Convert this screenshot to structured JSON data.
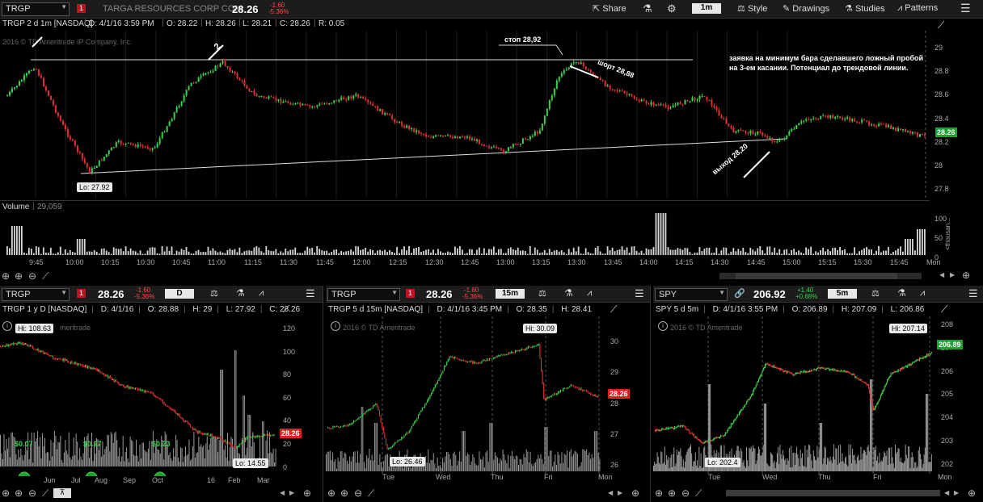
{
  "header": {
    "symbol": "TRGP",
    "company": "TARGA RESOURCES CORP COM",
    "price": "28.26",
    "chg": "-1.60",
    "chg_pct": "-5.36%",
    "share_label": "Share",
    "interval": "1m",
    "style_label": "Style",
    "drawings_label": "Drawings",
    "studies_label": "Studies",
    "patterns_label": "Patterns"
  },
  "main": {
    "info_title": "TRGP 2 d 1m [NASDAQ]",
    "info_d": "D: 4/1/16 3:59 PM",
    "info_o": "O: 28.22",
    "info_h": "H: 28.26",
    "info_l": "L: 28.21",
    "info_c": "C: 28.26",
    "info_r": "R: 0.05",
    "copyright": "2016 © TD Ameritrade IP Company, Inc.",
    "lo_label": "Lo: 27.92",
    "price_tag": "28.26",
    "touch_label": "2",
    "stop_label": "стоп 28,92",
    "short_label": "шорт 28,88",
    "exit_label": "выход 28,20",
    "note": "заявка на минимум бара сделавшего ложный пробой на 3-ем касании. Потенциал до трендовой линии.",
    "y_ticks": [
      "29",
      "28.8",
      "28.6",
      "28.4",
      "28.2",
      "28",
      "27.8"
    ],
    "x_ticks": [
      "9:45",
      "10:00",
      "10:15",
      "10:30",
      "10:45",
      "11:00",
      "11:15",
      "11:30",
      "11:45",
      "12:00",
      "12:15",
      "12:30",
      "12:45",
      "13:00",
      "13:15",
      "13:30",
      "13:45",
      "14:00",
      "14:15",
      "14:30",
      "14:45",
      "15:00",
      "15:15",
      "15:30",
      "15:45",
      "Mon"
    ],
    "volume_label": "Volume",
    "volume_value": "29,059",
    "vol_ticks": [
      "100",
      "50",
      "0"
    ],
    "vol_unit": "<thousan..."
  },
  "panel1": {
    "symbol": "TRGP",
    "price": "28.26",
    "chg": "-1.60",
    "chg_pct": "-5.36%",
    "interval": "D",
    "info_title": "TRGP 1 y D [NASDAQ]",
    "info_d": "D: 4/1/16",
    "info_o": "O: 28.88",
    "info_h": "H: 29",
    "info_l": "L: 27.92",
    "info_c": "C: 28.26",
    "copyright": "meritrade",
    "hi_label": "Hi: 108.63",
    "lo_label": "Lo: 14.55",
    "price_tag": "28.26",
    "div1": "$0.07",
    "div2": "$0.27",
    "div3": "$0.23",
    "y_ticks": [
      "120",
      "100",
      "80",
      "60",
      "40",
      "20",
      "0"
    ],
    "x_ticks": [
      "Jun",
      "Jul",
      "Aug",
      "Sep",
      "Oct",
      "16",
      "Feb",
      "Mar"
    ]
  },
  "panel2": {
    "symbol": "TRGP",
    "price": "28.26",
    "chg": "-1.60",
    "chg_pct": "-5.36%",
    "interval": "15m",
    "info_title": "TRGP 5 d 15m [NASDAQ]",
    "info_d": "D: 4/1/16 3:45 PM",
    "info_o": "O: 28.35",
    "info_h": "H: 28.41",
    "copyright": "2016 © TD Ameritrade",
    "hi_label": "Hi: 30.09",
    "lo_label": "Lo: 26.46",
    "price_tag": "28.26",
    "y_ticks": [
      "30",
      "29",
      "28",
      "27",
      "26"
    ],
    "x_ticks": [
      "Tue",
      "Wed",
      "Thu",
      "Fri",
      "Mon"
    ]
  },
  "panel3": {
    "symbol": "SPY",
    "price": "206.92",
    "chg": "+1.40",
    "chg_pct": "+0.68%",
    "interval": "5m",
    "info_title": "SPY 5 d 5m",
    "info_d": "D: 4/1/16 3:55 PM",
    "info_o": "O: 206.89",
    "info_h": "H: 207.09",
    "info_l": "L: 206.86",
    "copyright": "2016 © TD Ameritrade",
    "hi_label": "Hi: 207.14",
    "lo_label": "Lo: 202.4",
    "price_tag": "206.89",
    "y_ticks": [
      "208",
      "207",
      "206",
      "205",
      "204",
      "203",
      "202"
    ],
    "x_ticks": [
      "Tue",
      "Wed",
      "Thu",
      "Fri",
      "Mon"
    ]
  },
  "colors": {
    "up": "#3fd04f",
    "down": "#e03030",
    "accent_red": "#e02020",
    "accent_green": "#1fa02f"
  }
}
